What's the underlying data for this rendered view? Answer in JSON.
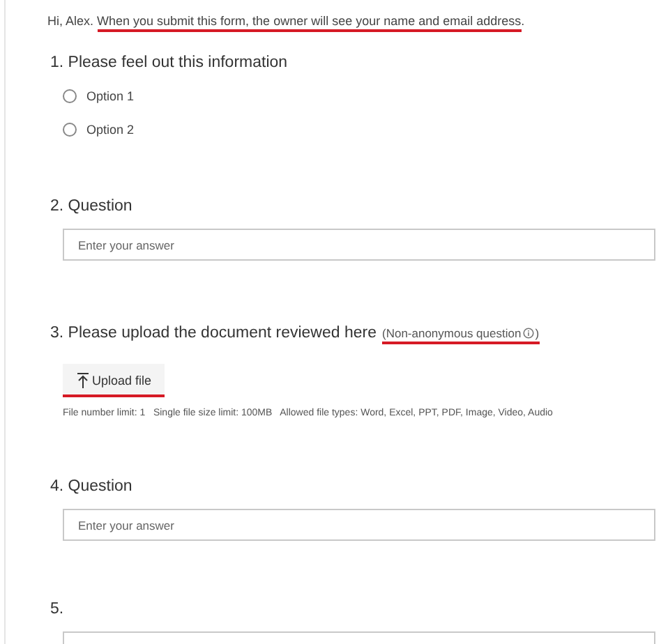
{
  "intro": [
    {
      "text": "Hi, Alex. ",
      "underlined": false
    },
    {
      "text": "When you submit this form, the owner will see your name and email address",
      "underlined": true
    },
    {
      "text": ".",
      "underlined": false
    }
  ],
  "questions": [
    {
      "kind": "choice",
      "number": "1.",
      "title": "Please feel out this information",
      "options": [
        {
          "label": "Option 1",
          "selected": false
        },
        {
          "label": "Option 2",
          "selected": false
        }
      ]
    },
    {
      "kind": "text",
      "number": "2.",
      "title": "Question",
      "placeholder": "Enter your answer"
    },
    {
      "kind": "upload",
      "number": "3.",
      "title": "Please upload the document reviewed here",
      "note": {
        "open": "(Non-anonymous question",
        "close": ")",
        "underlined": true
      },
      "button": {
        "label": "Upload file",
        "underlined": true
      },
      "limits": "File number limit: 1   Single file size limit: 100MB   Allowed file types: Word, Excel, PPT, PDF, Image, Video, Audio"
    },
    {
      "kind": "text",
      "number": "4.",
      "title": "Question",
      "placeholder": "Enter your answer"
    },
    {
      "kind": "text",
      "number": "5."
    }
  ]
}
